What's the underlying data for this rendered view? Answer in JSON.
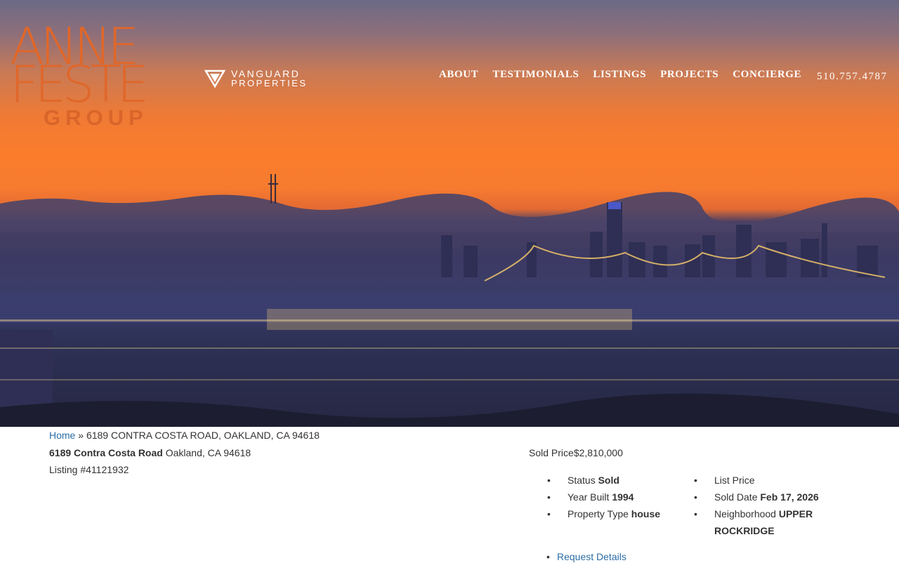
{
  "brand": {
    "logo_line1": "ANNE",
    "logo_line2": "FESTE",
    "logo_line3": "GROUP",
    "partner_line1": "VANGUARD",
    "partner_line2": "PROPERTIES"
  },
  "nav": {
    "items": [
      {
        "label": "ABOUT"
      },
      {
        "label": "TESTIMONIALS"
      },
      {
        "label": "LISTINGS"
      },
      {
        "label": "PROJECTS"
      },
      {
        "label": "CONCIERGE"
      }
    ],
    "phone": "510.757.4787"
  },
  "breadcrumb": {
    "home": "Home",
    "separator": " » ",
    "current": "6189 CONTRA COSTA ROAD, OAKLAND, CA 94618"
  },
  "listing": {
    "street": "6189 Contra Costa Road",
    "city_state_zip": " Oakland, CA 94618",
    "listing_number": "Listing #41121932",
    "sold_price_label": "Sold Price",
    "sold_price_value": "$2,810,000",
    "facts_col1": [
      {
        "label": "Status ",
        "value": "Sold"
      },
      {
        "label": "Year Built ",
        "value": "1994"
      },
      {
        "label": "Property Type ",
        "value": "house"
      }
    ],
    "facts_col2": [
      {
        "label": "List Price",
        "value": ""
      },
      {
        "label": "Sold Date ",
        "value": "Feb 17, 2026"
      },
      {
        "label": "Neighborhood ",
        "value": "UPPER ROCKRIDGE"
      }
    ],
    "request_link": "Request Details"
  },
  "colors": {
    "accent": "#e0672a",
    "link": "#2b6ea7",
    "sky_orange": "#fb7d2c"
  }
}
